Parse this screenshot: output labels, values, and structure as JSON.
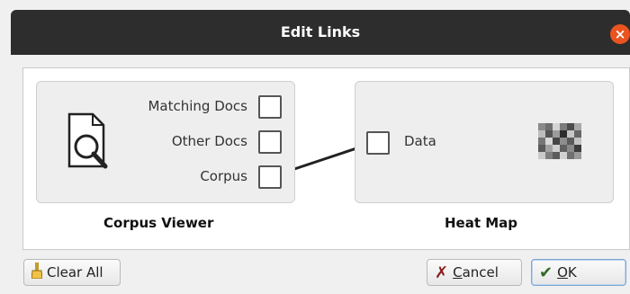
{
  "window": {
    "title": "Edit Links",
    "close_icon": "close-icon"
  },
  "source_widget": {
    "name": "Corpus Viewer",
    "icon": "document-search-icon",
    "outputs": [
      {
        "label": "Matching Docs",
        "linked": false
      },
      {
        "label": "Other Docs",
        "linked": false
      },
      {
        "label": "Corpus",
        "linked": true
      }
    ]
  },
  "target_widget": {
    "name": "Heat Map",
    "icon": "heatmap-icon",
    "inputs": [
      {
        "label": "Data",
        "linked": true
      }
    ]
  },
  "buttons": {
    "clear_all": "Clear All",
    "cancel": "Cancel",
    "ok": "OK"
  },
  "colors": {
    "titlebar": "#2d2d2d",
    "close": "#e95420",
    "link_line": "#222222"
  }
}
